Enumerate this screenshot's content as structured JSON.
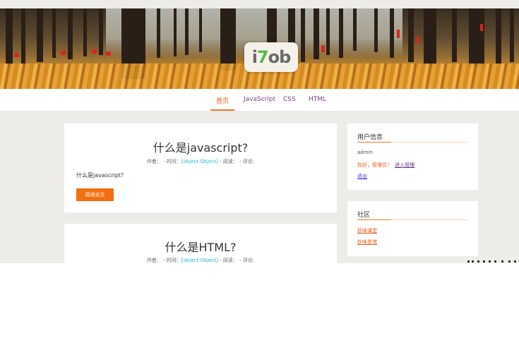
{
  "header": {
    "logo_part1": "i",
    "logo_part2": "7",
    "logo_part3": "ob"
  },
  "nav": {
    "items": [
      {
        "label": "首页",
        "active": true
      },
      {
        "label": "JavaScript",
        "active": false
      },
      {
        "label": "CSS",
        "active": false
      },
      {
        "label": "HTML",
        "active": false
      }
    ]
  },
  "posts": [
    {
      "title": "什么是javascript?",
      "meta_author": "作者：",
      "meta_time": " - 时间：",
      "meta_time_value": "[object Object]",
      "meta_views": " - 阅读：",
      "meta_comments": " - 评论:",
      "excerpt": "什么是javascript?",
      "read_more": "阅读全文"
    },
    {
      "title": "什么是HTML?",
      "meta_author": "作者：",
      "meta_time": " - 时间：",
      "meta_time_value": "[object Object]",
      "meta_views": " - 阅读：",
      "meta_comments": " - 评论:"
    }
  ],
  "sidebar": {
    "user_info": {
      "title": "用户信息",
      "username": "admin",
      "greeting": "你好，管理员！",
      "admin_link": "进入管理",
      "logout": "退出"
    },
    "community": {
      "title": "社区",
      "link1": "妙味课堂",
      "link2": "妙味茶馆"
    }
  },
  "colors": {
    "accent": "#f07a28",
    "nav_link": "#7b3e8a",
    "button": "#f36f10",
    "object_text": "#2ab5cf",
    "page_bg": "#edece8"
  }
}
